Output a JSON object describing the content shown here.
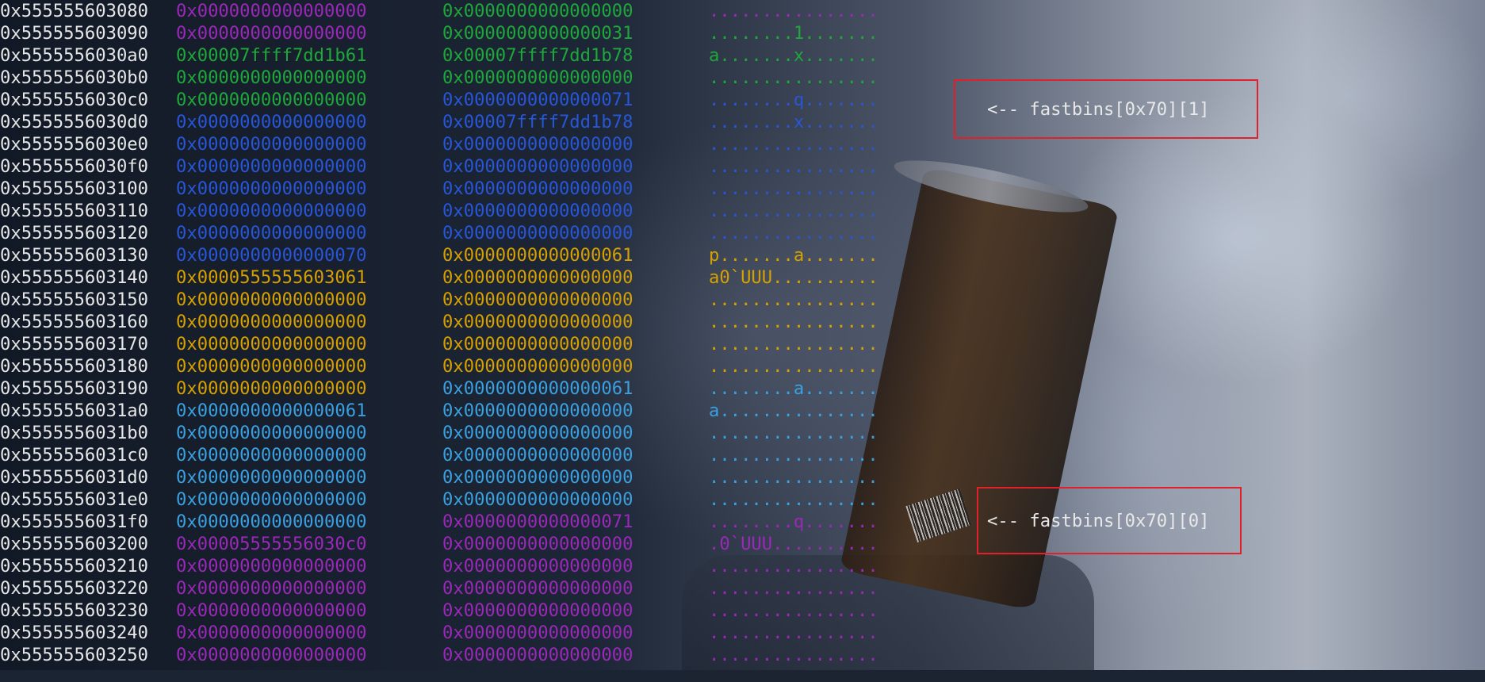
{
  "colors": {
    "address": "#e6e6e6",
    "magenta": "#9a28b8",
    "green": "#1ea83a",
    "blue": "#2856d8",
    "orange": "#d6a000",
    "light_blue": "#3aa0e0",
    "annotation_border": "#e0202a",
    "annotation_text": "#e8e8e8"
  },
  "rows": [
    {
      "addr": "0x555555603080",
      "w1": "0x0000000000000000",
      "w2": "0x0000000000000000",
      "ascii": "................",
      "c1": "magenta",
      "c2": "green",
      "c3": "magenta"
    },
    {
      "addr": "0x555555603090",
      "w1": "0x0000000000000000",
      "w2": "0x0000000000000031",
      "ascii": "........1.......",
      "c1": "magenta",
      "c2": "green",
      "c3": "green"
    },
    {
      "addr": "0x5555556030a0",
      "w1": "0x00007ffff7dd1b61",
      "w2": "0x00007ffff7dd1b78",
      "ascii": "a.......x.......",
      "c1": "green",
      "c2": "green",
      "c3": "green"
    },
    {
      "addr": "0x5555556030b0",
      "w1": "0x0000000000000000",
      "w2": "0x0000000000000000",
      "ascii": "................",
      "c1": "green",
      "c2": "green",
      "c3": "green"
    },
    {
      "addr": "0x5555556030c0",
      "w1": "0x0000000000000000",
      "w2": "0x0000000000000071",
      "ascii": "........q.......",
      "c1": "green",
      "c2": "blue",
      "c3": "blue"
    },
    {
      "addr": "0x5555556030d0",
      "w1": "0x0000000000000000",
      "w2": "0x00007ffff7dd1b78",
      "ascii": "........x.......",
      "c1": "blue",
      "c2": "blue",
      "c3": "blue"
    },
    {
      "addr": "0x5555556030e0",
      "w1": "0x0000000000000000",
      "w2": "0x0000000000000000",
      "ascii": "................",
      "c1": "blue",
      "c2": "blue",
      "c3": "blue"
    },
    {
      "addr": "0x5555556030f0",
      "w1": "0x0000000000000000",
      "w2": "0x0000000000000000",
      "ascii": "................",
      "c1": "blue",
      "c2": "blue",
      "c3": "blue"
    },
    {
      "addr": "0x555555603100",
      "w1": "0x0000000000000000",
      "w2": "0x0000000000000000",
      "ascii": "................",
      "c1": "blue",
      "c2": "blue",
      "c3": "blue"
    },
    {
      "addr": "0x555555603110",
      "w1": "0x0000000000000000",
      "w2": "0x0000000000000000",
      "ascii": "................",
      "c1": "blue",
      "c2": "blue",
      "c3": "blue"
    },
    {
      "addr": "0x555555603120",
      "w1": "0x0000000000000000",
      "w2": "0x0000000000000000",
      "ascii": "................",
      "c1": "blue",
      "c2": "blue",
      "c3": "blue"
    },
    {
      "addr": "0x555555603130",
      "w1": "0x0000000000000070",
      "w2": "0x0000000000000061",
      "ascii": "p.......a.......",
      "c1": "blue",
      "c2": "orange",
      "c3": "orange"
    },
    {
      "addr": "0x555555603140",
      "w1": "0x0000555555603061",
      "w2": "0x0000000000000000",
      "ascii": "a0`UUU..........",
      "c1": "orange",
      "c2": "orange",
      "c3": "orange"
    },
    {
      "addr": "0x555555603150",
      "w1": "0x0000000000000000",
      "w2": "0x0000000000000000",
      "ascii": "................",
      "c1": "orange",
      "c2": "orange",
      "c3": "orange"
    },
    {
      "addr": "0x555555603160",
      "w1": "0x0000000000000000",
      "w2": "0x0000000000000000",
      "ascii": "................",
      "c1": "orange",
      "c2": "orange",
      "c3": "orange"
    },
    {
      "addr": "0x555555603170",
      "w1": "0x0000000000000000",
      "w2": "0x0000000000000000",
      "ascii": "................",
      "c1": "orange",
      "c2": "orange",
      "c3": "orange"
    },
    {
      "addr": "0x555555603180",
      "w1": "0x0000000000000000",
      "w2": "0x0000000000000000",
      "ascii": "................",
      "c1": "orange",
      "c2": "orange",
      "c3": "orange"
    },
    {
      "addr": "0x555555603190",
      "w1": "0x0000000000000000",
      "w2": "0x0000000000000061",
      "ascii": "........a.......",
      "c1": "orange",
      "c2": "light_blue",
      "c3": "light_blue"
    },
    {
      "addr": "0x5555556031a0",
      "w1": "0x0000000000000061",
      "w2": "0x0000000000000000",
      "ascii": "a...............",
      "c1": "light_blue",
      "c2": "light_blue",
      "c3": "light_blue"
    },
    {
      "addr": "0x5555556031b0",
      "w1": "0x0000000000000000",
      "w2": "0x0000000000000000",
      "ascii": "................",
      "c1": "light_blue",
      "c2": "light_blue",
      "c3": "light_blue"
    },
    {
      "addr": "0x5555556031c0",
      "w1": "0x0000000000000000",
      "w2": "0x0000000000000000",
      "ascii": "................",
      "c1": "light_blue",
      "c2": "light_blue",
      "c3": "light_blue"
    },
    {
      "addr": "0x5555556031d0",
      "w1": "0x0000000000000000",
      "w2": "0x0000000000000000",
      "ascii": "................",
      "c1": "light_blue",
      "c2": "light_blue",
      "c3": "light_blue"
    },
    {
      "addr": "0x5555556031e0",
      "w1": "0x0000000000000000",
      "w2": "0x0000000000000000",
      "ascii": "................",
      "c1": "light_blue",
      "c2": "light_blue",
      "c3": "light_blue"
    },
    {
      "addr": "0x5555556031f0",
      "w1": "0x0000000000000000",
      "w2": "0x0000000000000071",
      "ascii": "........q.......",
      "c1": "light_blue",
      "c2": "magenta",
      "c3": "magenta"
    },
    {
      "addr": "0x555555603200",
      "w1": "0x00005555556030c0",
      "w2": "0x0000000000000000",
      "ascii": ".0`UUU..........",
      "c1": "magenta",
      "c2": "magenta",
      "c3": "magenta"
    },
    {
      "addr": "0x555555603210",
      "w1": "0x0000000000000000",
      "w2": "0x0000000000000000",
      "ascii": "................",
      "c1": "magenta",
      "c2": "magenta",
      "c3": "magenta"
    },
    {
      "addr": "0x555555603220",
      "w1": "0x0000000000000000",
      "w2": "0x0000000000000000",
      "ascii": "................",
      "c1": "magenta",
      "c2": "magenta",
      "c3": "magenta"
    },
    {
      "addr": "0x555555603230",
      "w1": "0x0000000000000000",
      "w2": "0x0000000000000000",
      "ascii": "................",
      "c1": "magenta",
      "c2": "magenta",
      "c3": "magenta"
    },
    {
      "addr": "0x555555603240",
      "w1": "0x0000000000000000",
      "w2": "0x0000000000000000",
      "ascii": "................",
      "c1": "magenta",
      "c2": "magenta",
      "c3": "magenta"
    },
    {
      "addr": "0x555555603250",
      "w1": "0x0000000000000000",
      "w2": "0x0000000000000000",
      "ascii": "................",
      "c1": "magenta",
      "c2": "magenta",
      "c3": "magenta"
    }
  ],
  "annotations": [
    {
      "text": "<-- fastbins[0x70][1]"
    },
    {
      "text": "<-- fastbins[0x70][0]"
    }
  ]
}
